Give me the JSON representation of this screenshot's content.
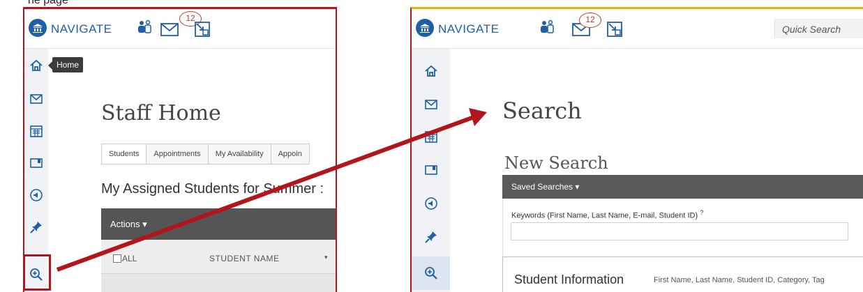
{
  "cut_text": "ne page",
  "brand_name": "NAVIGATE",
  "notification_count": "12",
  "left_screen": {
    "tooltip": "Home",
    "page_title": "Staff Home",
    "tabs": [
      "Students",
      "Appointments",
      "My Availability",
      "Appoin"
    ],
    "section_heading": "My Assigned Students for Summer :",
    "actions_label": "Actions ▾",
    "select_all_label": "ALL",
    "student_name_header": "STUDENT NAME",
    "sort_caret": "▾"
  },
  "right_screen": {
    "quick_search_placeholder": "Quick Search",
    "page_title": "Search",
    "new_search_title": "New Search",
    "saved_searches_label": "Saved Searches ▾",
    "keywords_label": "Keywords (First Name, Last Name, E-mail, Student ID)",
    "help_mark": "?",
    "student_info_title": "Student Information",
    "student_info_fields": "First Name, Last Name, Student ID, Category, Tag"
  },
  "sidebar_icons": [
    "home-icon",
    "mail-icon",
    "calendar-icon",
    "folder-icon",
    "megaphone-icon",
    "pin-icon",
    "search-plus-icon"
  ],
  "colors": {
    "brand_blue": "#1f5fa8",
    "annotation_red": "#b2151b",
    "header_gray": "#555555",
    "accent_yellow": "#e8b100"
  }
}
